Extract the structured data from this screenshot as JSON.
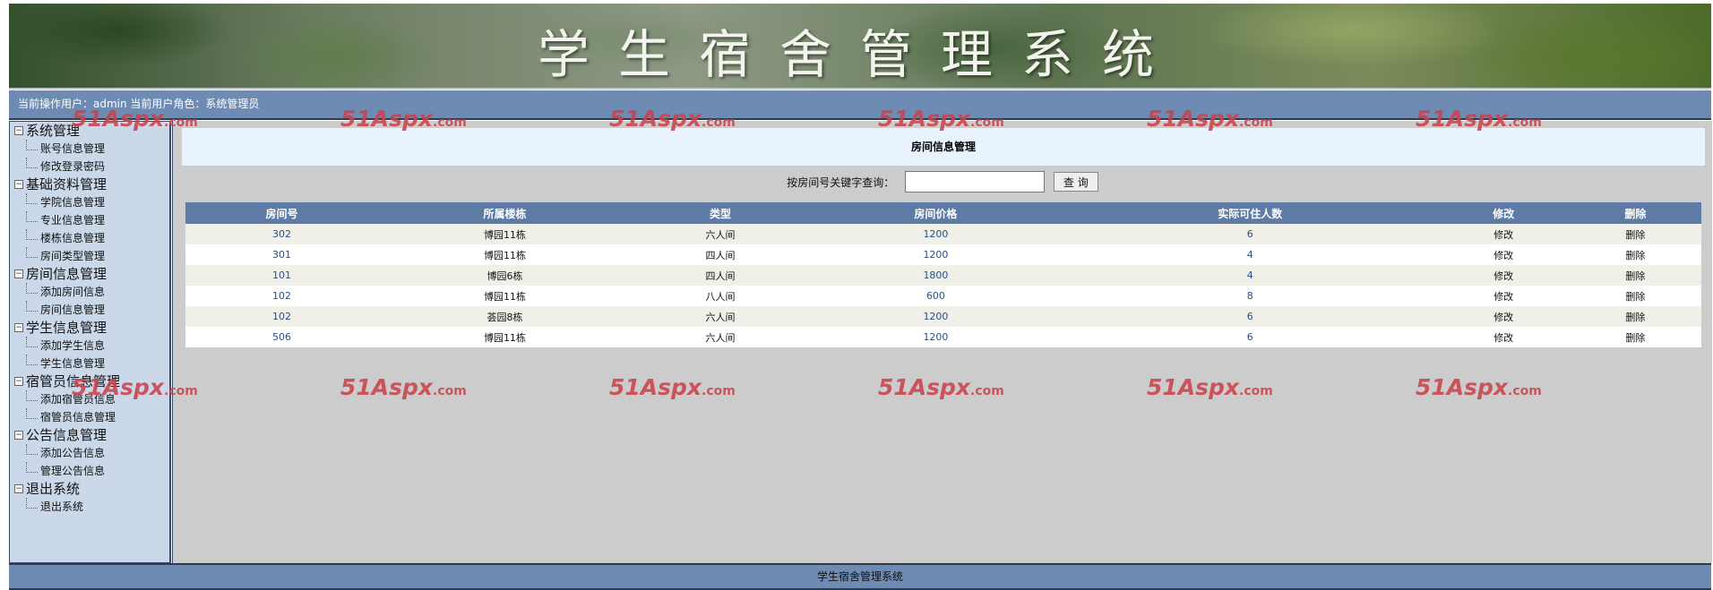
{
  "banner": {
    "title": "学生宿舍管理系统"
  },
  "userbar": {
    "text": "当前操作用户：admin 当前用户角色：系统管理员"
  },
  "sidebar": {
    "groups": [
      {
        "title": "系统管理",
        "items": [
          "账号信息管理",
          "修改登录密码"
        ]
      },
      {
        "title": "基础资料管理",
        "items": [
          "学院信息管理",
          "专业信息管理",
          "楼栋信息管理",
          "房间类型管理"
        ]
      },
      {
        "title": "房间信息管理",
        "items": [
          "添加房间信息",
          "房间信息管理"
        ]
      },
      {
        "title": "学生信息管理",
        "items": [
          "添加学生信息",
          "学生信息管理"
        ]
      },
      {
        "title": "宿管员信息管理",
        "items": [
          "添加宿管员信息",
          "宿管员信息管理"
        ]
      },
      {
        "title": "公告信息管理",
        "items": [
          "添加公告信息",
          "管理公告信息"
        ]
      },
      {
        "title": "退出系统",
        "items": [
          "退出系统"
        ]
      }
    ]
  },
  "main": {
    "page_title": "房间信息管理",
    "search": {
      "label": "按房间号关键字查询：",
      "value": "",
      "button": "查 询"
    },
    "table": {
      "headers": [
        "房间号",
        "所属楼栋",
        "类型",
        "房间价格",
        "实际可住人数",
        "修改",
        "删除"
      ],
      "rows": [
        [
          "302",
          "博园11栋",
          "六人间",
          "1200",
          "6",
          "修改",
          "删除"
        ],
        [
          "301",
          "博园11栋",
          "四人间",
          "1200",
          "4",
          "修改",
          "删除"
        ],
        [
          "101",
          "博园6栋",
          "四人间",
          "1800",
          "4",
          "修改",
          "删除"
        ],
        [
          "102",
          "博园11栋",
          "八人间",
          "600",
          "8",
          "修改",
          "删除"
        ],
        [
          "102",
          "荟园8栋",
          "六人间",
          "1200",
          "6",
          "修改",
          "删除"
        ],
        [
          "506",
          "博园11栋",
          "六人间",
          "1200",
          "6",
          "修改",
          "删除"
        ]
      ]
    }
  },
  "footer": {
    "text": "学生宿舍管理系统"
  },
  "watermark": {
    "brand": "51Aspx",
    "suffix": ".com"
  },
  "colors": {
    "header_bar": "#6e8bb4",
    "table_header": "#5d7ba5",
    "sidebar": "#cbd8ea",
    "content_bg": "#cccccc",
    "watermark": "#c9444d"
  }
}
